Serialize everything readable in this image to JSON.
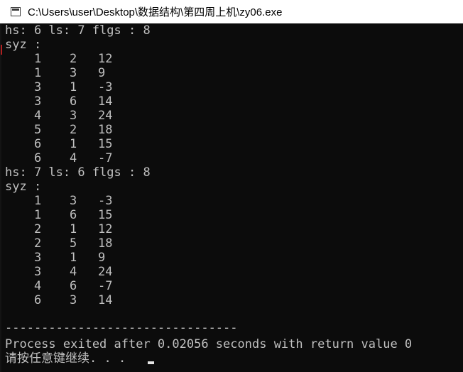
{
  "window": {
    "title": "C:\\Users\\user\\Desktop\\数据结构\\第四周上机\\zy06.exe"
  },
  "console": {
    "header1": "hs: 6 ls: 7 flgs : 8",
    "label1": "syz :",
    "block1": [
      [
        "1",
        "2",
        "12"
      ],
      [
        "1",
        "3",
        "9"
      ],
      [
        "3",
        "1",
        "-3"
      ],
      [
        "3",
        "6",
        "14"
      ],
      [
        "4",
        "3",
        "24"
      ],
      [
        "5",
        "2",
        "18"
      ],
      [
        "6",
        "1",
        "15"
      ],
      [
        "6",
        "4",
        "-7"
      ]
    ],
    "header2": "hs: 7 ls: 6 flgs : 8",
    "label2": "syz :",
    "block2": [
      [
        "1",
        "3",
        "-3"
      ],
      [
        "1",
        "6",
        "15"
      ],
      [
        "2",
        "1",
        "12"
      ],
      [
        "2",
        "5",
        "18"
      ],
      [
        "3",
        "1",
        "9"
      ],
      [
        "3",
        "4",
        "24"
      ],
      [
        "4",
        "6",
        "-7"
      ],
      [
        "6",
        "3",
        "14"
      ]
    ],
    "separator": "--------------------------------",
    "process_line": "Process exited after 0.02056 seconds with return value 0",
    "prompt_line": "请按任意键继续. . ."
  },
  "icons": {
    "window_icon": "console-window-icon",
    "cursor": "text-cursor"
  },
  "colors": {
    "console_bg": "#0c0c0c",
    "console_text": "#c0c0c0",
    "titlebar_bg": "#ffffff"
  }
}
